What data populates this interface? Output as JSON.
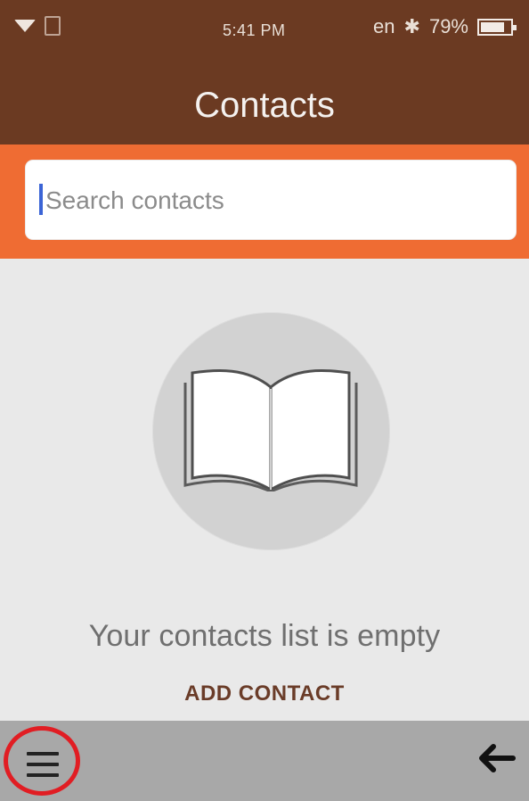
{
  "status_bar": {
    "time": "5:41 PM",
    "language": "en",
    "bluetooth_icon": "bluetooth-icon",
    "battery_text": "79%",
    "battery_icon": "battery-icon",
    "wifi_icon": "wifi-icon",
    "sim_icon": "sim-card-icon"
  },
  "header": {
    "title": "Contacts"
  },
  "search": {
    "placeholder": "Search contacts",
    "value": ""
  },
  "empty_state": {
    "icon": "open-book-icon",
    "message": "Your contacts list is empty",
    "action_label": "ADD CONTACT"
  },
  "bottom_bar": {
    "menu_icon": "hamburger-menu-icon",
    "back_icon": "back-arrow-icon"
  },
  "colors": {
    "header": "#6b3a22",
    "accent": "#ef6c33",
    "background": "#e9e9e9",
    "bottom_bar": "#a8a8a8",
    "highlight": "#e11d23"
  }
}
